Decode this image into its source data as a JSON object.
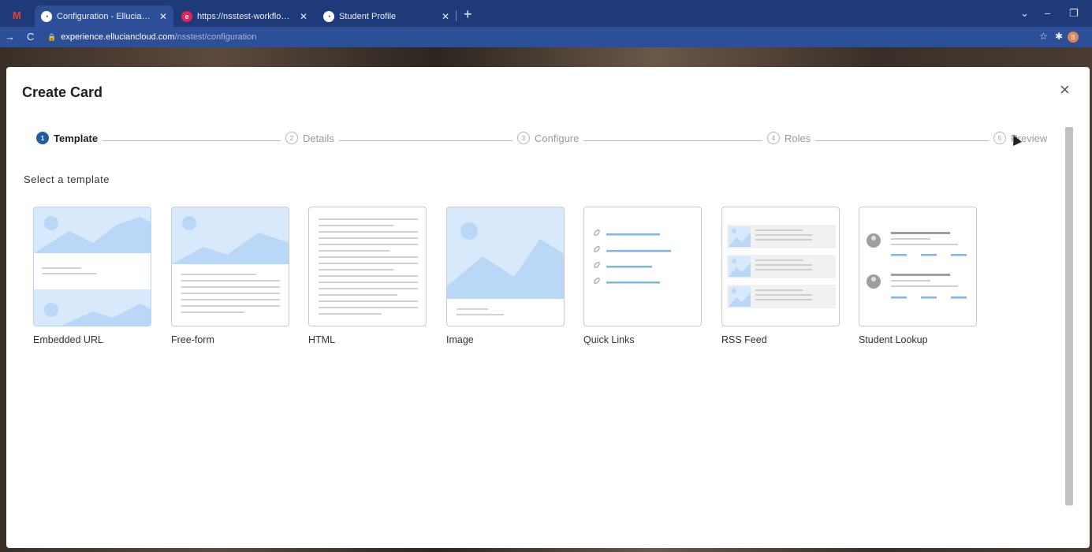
{
  "browser": {
    "tabs": [
      {
        "title": "Configuration - Ellucian Experien",
        "favicon": "ellucian-icon",
        "active": true
      },
      {
        "title": "https://nsstest-workflow.ellucian",
        "favicon": "e-icon",
        "active": false
      },
      {
        "title": "Student Profile",
        "favicon": "ellucian-icon",
        "active": false
      }
    ],
    "gmail_glyph": "M",
    "close_glyph": "✕",
    "newtab_glyph": "+",
    "url_host": "experience.elluciancloud.com",
    "url_path": "/nsstest/configuration",
    "profile_initial": "B",
    "accent": "#1f3a78"
  },
  "modal": {
    "title": "Create Card",
    "close_glyph": "×",
    "steps": [
      {
        "num": "1",
        "label": "Template",
        "active": true
      },
      {
        "num": "2",
        "label": "Details",
        "active": false
      },
      {
        "num": "3",
        "label": "Configure",
        "active": false
      },
      {
        "num": "4",
        "label": "Roles",
        "active": false
      },
      {
        "num": "5",
        "label": "Preview",
        "active": false
      }
    ],
    "section_label": "Select a template",
    "templates": [
      {
        "label": "Embedded URL",
        "icon": "embedded-url-thumbnail",
        "selected": true
      },
      {
        "label": "Free-form",
        "icon": "free-form-thumbnail",
        "selected": false
      },
      {
        "label": "HTML",
        "icon": "html-thumbnail",
        "selected": false
      },
      {
        "label": "Image",
        "icon": "image-thumbnail",
        "selected": false
      },
      {
        "label": "Quick Links",
        "icon": "quick-links-thumbnail",
        "selected": false
      },
      {
        "label": "RSS Feed",
        "icon": "rss-feed-thumbnail",
        "selected": false
      },
      {
        "label": "Student Lookup",
        "icon": "student-lookup-thumbnail",
        "selected": false
      }
    ],
    "active_step_color": "#1c5ea8",
    "thumbnail_blue": "#b9d7f7"
  }
}
